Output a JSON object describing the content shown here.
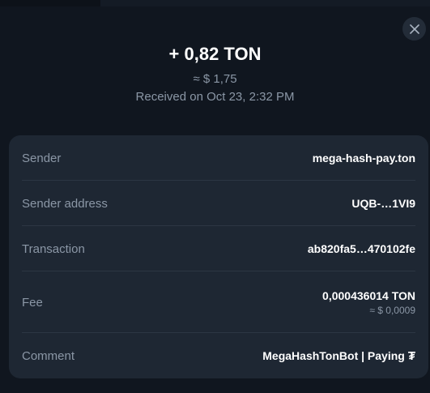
{
  "header": {
    "amount": "+ 0,82 TON",
    "fiat": "≈ $ 1,75",
    "received": "Received on Oct 23, 2:32 PM"
  },
  "close": {
    "icon": "close-icon"
  },
  "details": {
    "sender_label": "Sender",
    "sender_value": "mega-hash-pay.ton",
    "address_label": "Sender address",
    "address_value": "UQB-…1VI9",
    "transaction_label": "Transaction",
    "transaction_value": "ab820fa5…470102fe",
    "fee_label": "Fee",
    "fee_value": "0,000436014 TON",
    "fee_fiat": "≈ $ 0,0009",
    "comment_label": "Comment",
    "comment_value": "MegaHashTonBot | Paying",
    "comment_glyph": "₮"
  },
  "colors": {
    "background": "#10161f",
    "card": "#1e2733",
    "muted_text": "#8b97a6",
    "primary_text": "#ffffff"
  }
}
